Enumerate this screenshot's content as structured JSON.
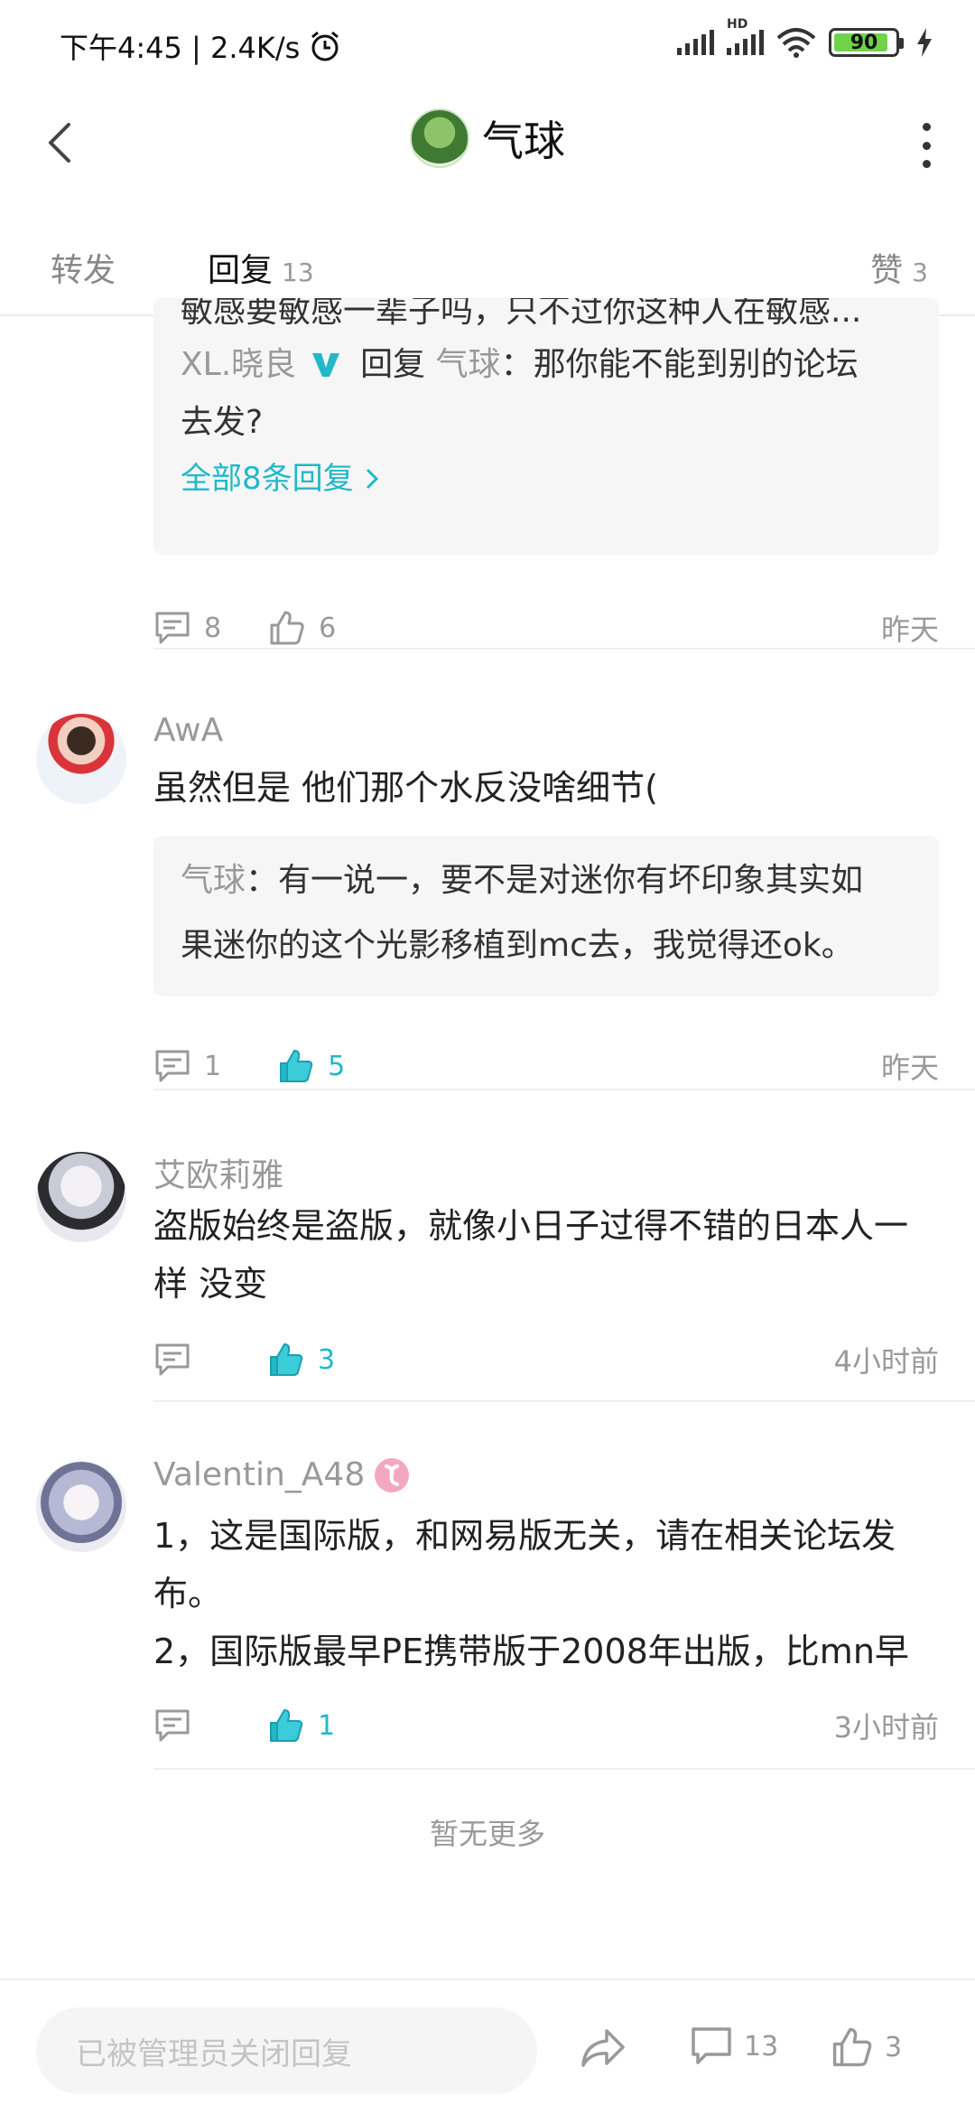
{
  "status_bar": {
    "time_speed": "下午4:45 | 2.4K/s",
    "hd_label": "HD",
    "battery": "90"
  },
  "header": {
    "title": "气球"
  },
  "tabs": [
    {
      "label": "转发",
      "count": ""
    },
    {
      "label": "回复",
      "count": "13"
    },
    {
      "label": "赞",
      "count": "3"
    }
  ],
  "first_item": {
    "truncated_line": "敏感要敏感一辈子吗，只不过你这种人在敏感...",
    "reply_author": "XL.晓良",
    "reply_word": "回复",
    "reply_target": "气球",
    "reply_text_line1": "：那你能不能到别的论坛",
    "reply_text_line2": "去发?",
    "all_replies": "全部8条回复",
    "comment_count": "8",
    "like_count": "6",
    "time": "昨天"
  },
  "comments": [
    {
      "username": "AwA",
      "text": "虽然但是 他们那个水反没啥细节(",
      "quote_author": "气球",
      "quote_text_line1": "：有一说一，要不是对迷你有坏印象其实如",
      "quote_text_line2": "果迷你的这个光影移植到mc去，我觉得还ok。",
      "comment_count": "1",
      "like_count": "5",
      "time": "昨天"
    },
    {
      "username": "艾欧莉雅",
      "text_line1": "盗版始终是盗版，就像小日子过得不错的日本人一",
      "text_line2": "样 没变",
      "like_count": "3",
      "time": "4小时前"
    },
    {
      "username": "Valentin_A48",
      "text_line1": "1，这是国际版，和网易版无关，请在相关论坛发",
      "text_line2": "布。",
      "text_line3": "2，国际版最早PE携带版于2008年出版，比mn早",
      "like_count": "1",
      "time": "3小时前"
    }
  ],
  "no_more": "暂无更多",
  "bottom_bar": {
    "input_placeholder": "已被管理员关闭回复",
    "comment_count": "13",
    "like_count": "3"
  },
  "colors": {
    "accent": "#21b8c9",
    "muted": "#999999",
    "battery_fill": "#6fd34a"
  }
}
